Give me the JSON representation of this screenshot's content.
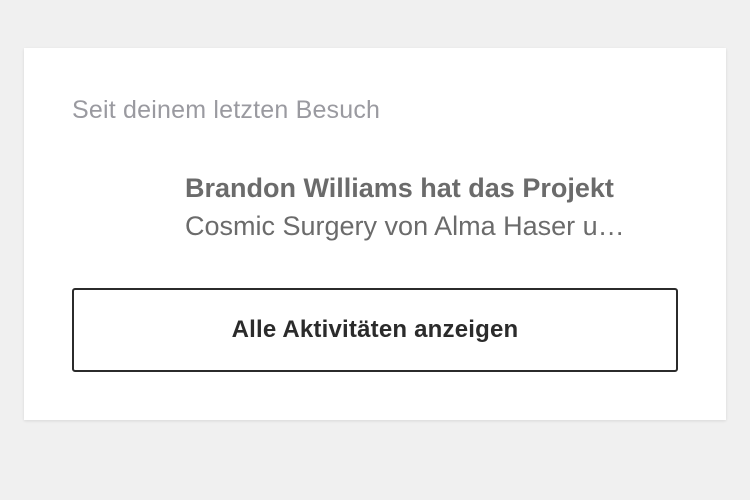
{
  "card": {
    "section_label": "Seit deinem letzten Besuch",
    "activity": {
      "line1": "Brandon Williams hat das Projekt",
      "line2": "Cosmic Surgery von Alma Haser u…"
    },
    "button_label": "Alle Aktivitäten anzeigen"
  },
  "colors": {
    "page_background": "#f0f0f0",
    "card_background": "#ffffff",
    "muted_text": "#9a9aa0",
    "activity_text": "#6b6b6b",
    "button_border": "#2b2b2b"
  }
}
